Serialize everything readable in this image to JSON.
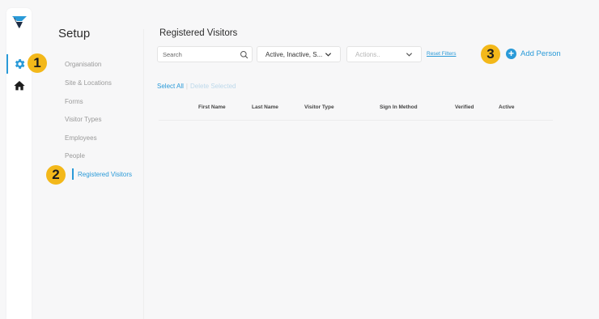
{
  "app": {
    "brand": "V",
    "colors": {
      "accent": "#2a9ad8",
      "badge": "#f3b81a",
      "logo_dark": "#1f2d44"
    }
  },
  "rail": {
    "items": [
      {
        "icon": "gear-icon",
        "active": true
      },
      {
        "icon": "home-icon",
        "active": false
      }
    ]
  },
  "badges": {
    "one": "1",
    "two": "2",
    "three": "3"
  },
  "setup": {
    "title": "Setup",
    "nav": [
      {
        "label": "Organisation"
      },
      {
        "label": "Site & Locations"
      },
      {
        "label": "Forms"
      },
      {
        "label": "Visitor Types"
      },
      {
        "label": "Employees"
      },
      {
        "label": "People"
      },
      {
        "label": "Registered Visitors",
        "active": true
      }
    ]
  },
  "main": {
    "title": "Registered Visitors",
    "search": {
      "placeholder": "Search"
    },
    "status_filter": {
      "value": "Active, Inactive, S..."
    },
    "actions": {
      "placeholder": "Actions.."
    },
    "reset_filters": "Reset Filters",
    "add_person": "Add Person",
    "select_all": "Select All",
    "separator": "|",
    "delete_selected": "Delete Selected",
    "table": {
      "columns": [
        "First Name",
        "Last Name",
        "Visitor Type",
        "Sign In Method",
        "Verified",
        "Active"
      ],
      "rows": []
    }
  }
}
